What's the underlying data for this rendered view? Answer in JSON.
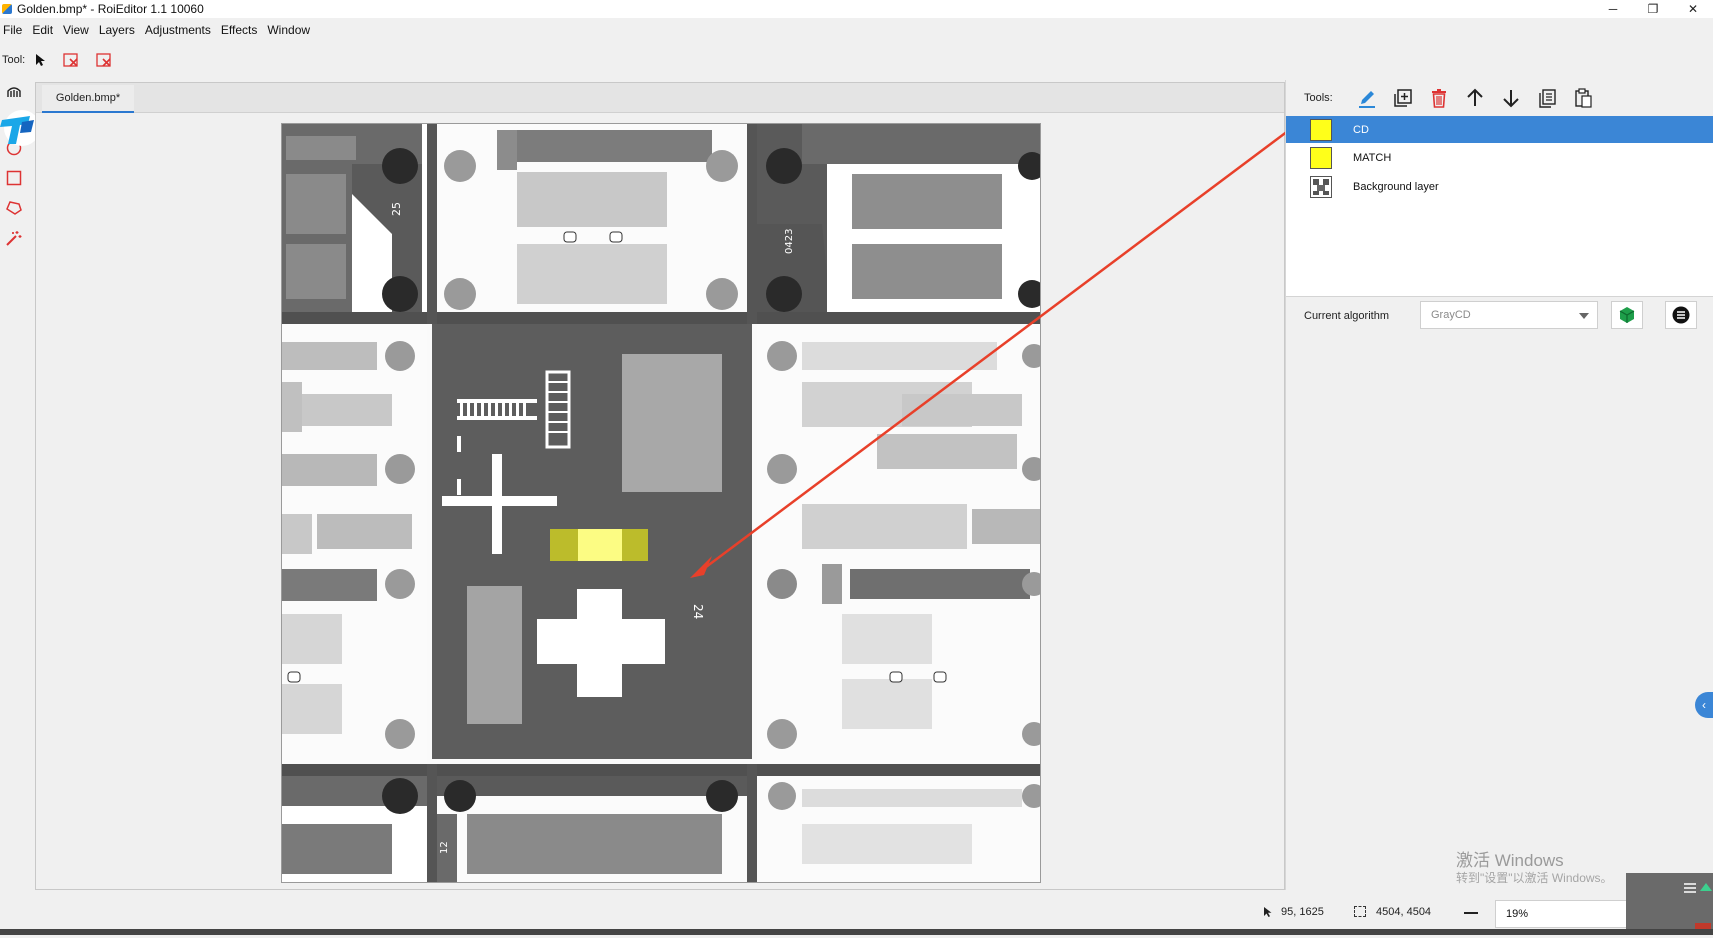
{
  "window": {
    "title": "Golden.bmp* - RoiEditor 1.1 10060",
    "minimize": "─",
    "maximize": "❐",
    "close": "✕"
  },
  "menu": [
    "File",
    "Edit",
    "View",
    "Layers",
    "Adjustments",
    "Effects",
    "Window"
  ],
  "toolbar": {
    "label": "Tool:"
  },
  "document": {
    "tab": "Golden.bmp*"
  },
  "right_panel": {
    "tools_label": "Tools:",
    "layers": [
      {
        "name": "CD",
        "color": "#ffff1a",
        "selected": true
      },
      {
        "name": "MATCH",
        "color": "#ffff1a",
        "selected": false
      },
      {
        "name": "Background layer",
        "selected": false
      }
    ],
    "algorithm_label": "Current algorithm",
    "algorithm_value": "GrayCD"
  },
  "canvas_labels": [
    "25",
    "0423",
    "24",
    "12"
  ],
  "watermark": {
    "line1": "激活 Windows",
    "line2": "转到\"设置\"以激活 Windows。"
  },
  "status": {
    "cursor": "95, 1625",
    "size": "4504, 4504",
    "zoom": "19%"
  },
  "colors": {
    "accent": "#3b86d6",
    "roi": "#ffff1a",
    "annotation_arrow": "#e8402a"
  }
}
